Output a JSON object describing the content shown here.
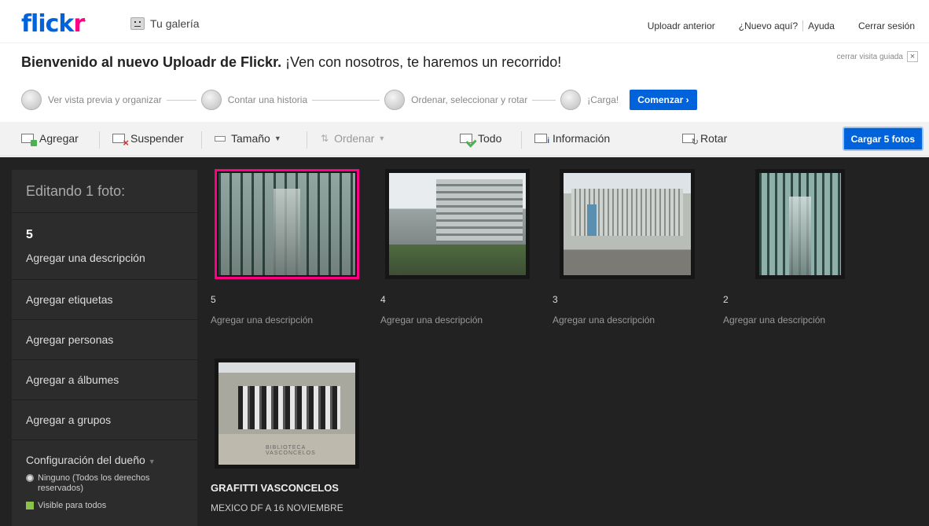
{
  "nav": {
    "logo_a": "flick",
    "logo_b": "r",
    "gallery": "Tu galería",
    "links": [
      "Uploadr anterior",
      "¿Nuevo aquí?",
      "Ayuda",
      "Cerrar sesión"
    ]
  },
  "tour": {
    "title_bold": "Bienvenido al nuevo Uploadr de Flickr.",
    "title_rest": " ¡Ven con nosotros, te haremos un recorrido!",
    "close": "cerrar visita guiada",
    "steps": [
      "Ver vista previa y organizar",
      "Contar una historia",
      "Ordenar, seleccionar y rotar",
      "¡Carga!"
    ],
    "start": "Comenzar ›"
  },
  "toolbar": {
    "add": "Agregar",
    "suspend": "Suspender",
    "size": "Tamaño",
    "sort": "Ordenar",
    "all": "Todo",
    "info": "Información",
    "rotate": "Rotar",
    "upload": "Cargar 5 fotos"
  },
  "sidebar": {
    "heading": "Editando 1 foto:",
    "current_num": "5",
    "current_desc": "Agregar una descripción",
    "items": [
      "Agregar etiquetas",
      "Agregar personas",
      "Agregar a álbumes",
      "Agregar a grupos"
    ],
    "owner": "Configuración del dueño",
    "opt_license": "Ninguno (Todos los derechos reservados)",
    "opt_visible": "Visible para todos"
  },
  "photos": [
    {
      "num": "5",
      "desc": "Agregar una descripción"
    },
    {
      "num": "4",
      "desc": "Agregar una descripción"
    },
    {
      "num": "3",
      "desc": "Agregar una descripción"
    },
    {
      "num": "2",
      "desc": "Agregar una descripción"
    },
    {
      "title": "GRAFITTI VASCONCELOS",
      "sub": "MEXICO DF A 16 NOVIEMBRE"
    }
  ]
}
